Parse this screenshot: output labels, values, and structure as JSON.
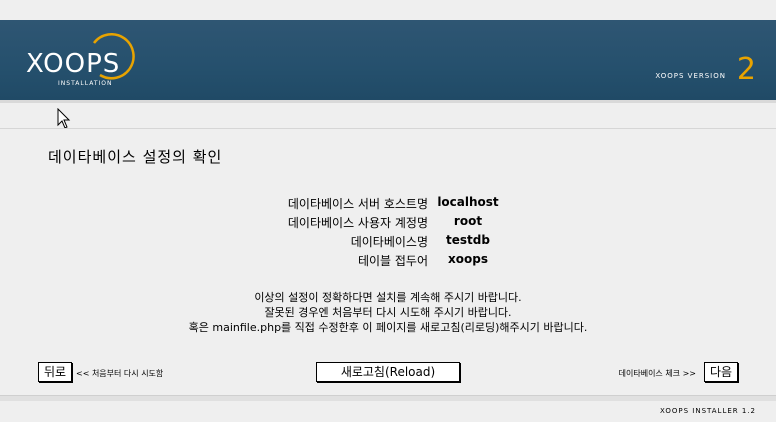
{
  "header": {
    "logo_text": "XOOPS",
    "logo_subtext": "INSTALLATION",
    "version_label": "XOOPS VERSION",
    "version_number": "2",
    "accent_color": "#e8a300",
    "header_color": "#2a5270"
  },
  "page": {
    "title": "데이타베이스 설정의 확인"
  },
  "settings": [
    {
      "label": "데이타베이스 서버 호스트명",
      "value": "localhost"
    },
    {
      "label": "데이타베이스 사용자 계정명",
      "value": "root"
    },
    {
      "label": "데이타베이스명",
      "value": "testdb"
    },
    {
      "label": "테이블 접두어",
      "value": "xoops"
    }
  ],
  "message": {
    "line1": "이상의 설정이 정확하다면 설치를 계속해 주시기 바랍니다.",
    "line2": "잘못된 경우엔 처음부터 다시 시도해 주시기 바랍니다.",
    "line3": "혹은 mainfile.php를 직접 수정한후 이 페이지를 새로고침(리로딩)해주시기 바랍니다."
  },
  "nav": {
    "back_button": "뒤로",
    "back_text": "<< 처음부터 다시 시도함",
    "reload_button": "새로고침(Reload)",
    "next_text": "데이타베이스 체크 >>",
    "next_button": "다음"
  },
  "footer": {
    "text": "XOOPS INSTALLER 1.2"
  }
}
